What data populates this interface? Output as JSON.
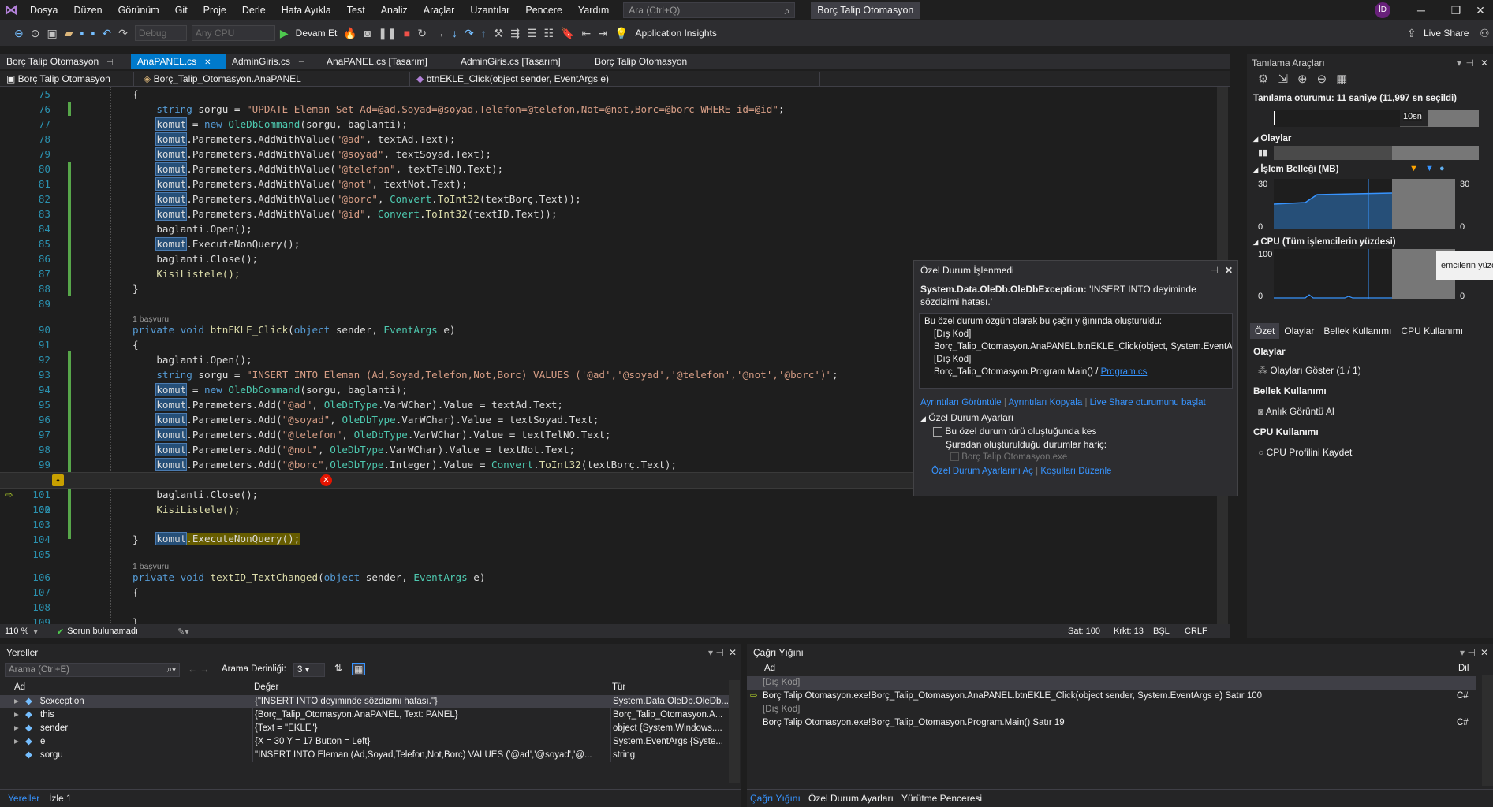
{
  "menu": {
    "items": [
      "Dosya",
      "Düzen",
      "Görünüm",
      "Git",
      "Proje",
      "Derle",
      "Hata Ayıkla",
      "Test",
      "Analiz",
      "Araçlar",
      "Uzantılar",
      "Pencere",
      "Yardım"
    ],
    "search_placeholder": "Ara (Ctrl+Q)",
    "solution": "Borç Talip Otomasyon",
    "avatar": "İD"
  },
  "toolbar": {
    "config": "Debug",
    "platform": "Any CPU",
    "continue": "Devam Et",
    "insights": "Application Insights",
    "live_share": "Live Share"
  },
  "tabs": [
    "Borç Talip Otomasyon",
    "AnaPANEL.cs",
    "AdminGiris.cs",
    "AnaPANEL.cs [Tasarım]",
    "AdminGiris.cs [Tasarım]",
    "Borç Talip Otomasyon"
  ],
  "navbar": {
    "project": "Borç Talip Otomasyon",
    "class": "Borç_Talip_Otomasyon.AnaPANEL",
    "member": "btnEKLE_Click(object sender, EventArgs e)"
  },
  "code": {
    "refs1": "1 başvuru",
    "refs2": "1 başvuru",
    "l75": "{",
    "l76a": "string",
    "l76b": " sorgu = ",
    "l76c": "\"UPDATE Eleman Set Ad=@ad,Soyad=@soyad,Telefon=@telefon,Not=@not,Borc=@borc WHERE id=@id\"",
    "l76d": ";",
    "l77": "komut",
    "l77b": " = ",
    "l77c": "new ",
    "l77d": "OleDbCommand",
    "l77e": "(sorgu, baglanti);",
    "p78": "\"@ad\"",
    "p78b": ", textAd.Text);",
    "p79": "\"@soyad\"",
    "p79b": ", textSoyad.Text);",
    "p80": "\"@telefon\"",
    "p80b": ", textTelNO.Text);",
    "p81": "\"@not\"",
    "p81b": ", textNot.Text);",
    "p82": "\"@borc\"",
    "p82b": "(textBorç.Text));",
    "p83": "\"@id\"",
    "p83b": "(textID.Text));",
    "addwv": ".Parameters.AddWithValue(",
    "conv": "Convert",
    "toint": "ToInt32",
    "l84": "baglanti.Open();",
    "l85": ".ExecuteNonQuery();",
    "l86": "baglanti.Close();",
    "l87": "KisiListele();",
    "l88": "}",
    "l90a": "private ",
    "l90b": "void ",
    "l90c": "btnEKLE_Click",
    "l90d": "(",
    "l90e": "object ",
    "l90f": "sender, ",
    "l90g": "EventArgs ",
    "l90h": "e)",
    "l91": "{",
    "l92": "baglanti.Open();",
    "l93c": "\"INSERT INTO Eleman (Ad,Soyad,Telefon,Not,Borc) VALUES ('@ad','@soyad','@telefon','@not','@borc')\"",
    "padd": ".Parameters.Add(",
    "oledbtype": "OleDbType",
    "q95": "\"@ad\"",
    "q95b": ".VarWChar).Value = textAd.Text;",
    "q96": "\"@soyad\"",
    "q96b": ".VarWChar).Value = textSoyad.Text;",
    "q97": "\"@telefon\"",
    "q97b": ".VarWChar).Value = textTelNO.Text;",
    "q98": "\"@not\"",
    "q98b": ".VarWChar).Value = textNot.Text;",
    "q99": "\"@borc\"",
    "q99b": ".Integer).Value = ",
    "q99c": "(textBorç.Text);",
    "l101": "baglanti.Close();",
    "l102": "KisiListele();",
    "l104": "}",
    "l106c": "textID_TextChanged",
    "l107": "{",
    "l109": "}"
  },
  "exception": {
    "header": "Özel Durum İşlenmedi",
    "type": "System.Data.OleDb.OleDbException:",
    "message": " 'INSERT INTO deyiminde sözdizimi hatası.'",
    "stack_intro": "Bu özel durum özgün olarak bu çağrı yığınında oluşturuldu:",
    "stack": [
      "[Dış Kod]",
      "Borç_Talip_Otomasyon.AnaPANEL.btnEKLE_Click(object, System.EventArgs)",
      "[Dış Kod]",
      "Borç_Talip_Otomasyon.Program.Main() / "
    ],
    "program_link": "Program.cs",
    "links": [
      "Ayrıntıları Görüntüle",
      "Ayrıntıları Kopyala",
      "Live Share oturumunu başlat"
    ],
    "settings_title": "Özel Durum Ayarları",
    "break_label": "Bu özel durum türü oluştuğunda kes",
    "except_label": "Şuradan oluşturulduğu durumlar hariç:",
    "except_item": "Borç Talip Otomasyon.exe",
    "settings_links": [
      "Özel Durum Ayarlarını Aç",
      "Koşulları Düzenle"
    ]
  },
  "diagnostics": {
    "title": "Tanılama Araçları",
    "session": "Tanılama oturumu: 11 saniye (11,997 sn seçildi)",
    "time_label": "10sn",
    "events": "Olaylar",
    "memory": "İşlem Belleği (MB)",
    "mem_max": "30",
    "mem_min": "0",
    "cpu": "CPU (Tüm işlemcilerin yüzdesi)",
    "cpu_max": "100",
    "cpu_min": "0",
    "tooltip": "emcilerin yüzd",
    "subtabs": [
      "Özet",
      "Olaylar",
      "Bellek Kullanımı",
      "CPU Kullanımı"
    ],
    "sec_events": "Olaylar",
    "show_events": "Olayları Göster (1 / 1)",
    "sec_memory": "Bellek Kullanımı",
    "snapshot": "Anlık Görüntü Al",
    "sec_cpu": "CPU Kullanımı",
    "cpu_profile": "CPU Profilini Kaydet"
  },
  "status": {
    "zoom": "110 %",
    "issues": "Sorun bulunamadı",
    "line": "Sat: 100",
    "char": "Krkt: 13",
    "space": "BŞL",
    "eol": "CRLF"
  },
  "locals": {
    "title": "Yereller",
    "search": "Arama (Ctrl+E)",
    "depth_label": "Arama Derinliği:",
    "depth": "3",
    "headers": [
      "Ad",
      "Değer",
      "Tür"
    ],
    "rows": [
      {
        "name": "$exception",
        "value": "{\"INSERT INTO deyiminde sözdizimi hatası.\"}",
        "type": "System.Data.OleDb.OleDb..."
      },
      {
        "name": "this",
        "value": "{Borç_Talip_Otomasyon.AnaPANEL, Text: PANEL}",
        "type": "Borç_Talip_Otomasyon.A..."
      },
      {
        "name": "sender",
        "value": "{Text = \"EKLE\"}",
        "type": "object {System.Windows...."
      },
      {
        "name": "e",
        "value": "{X = 30 Y = 17 Button = Left}",
        "type": "System.EventArgs {Syste..."
      },
      {
        "name": "sorgu",
        "value": "\"INSERT INTO Eleman (Ad,Soyad,Telefon,Not,Borc) VALUES ('@ad','@soyad','@...",
        "type": "string"
      }
    ],
    "bottom_tabs": [
      "Yereller",
      "İzle 1"
    ]
  },
  "callstack": {
    "title": "Çağrı Yığını",
    "headers": [
      "Ad",
      "Dil"
    ],
    "rows": [
      {
        "name": "[Dış Kod]",
        "lang": ""
      },
      {
        "name": "Borç Talip Otomasyon.exe!Borç_Talip_Otomasyon.AnaPANEL.btnEKLE_Click(object sender, System.EventArgs e) Satır 100",
        "lang": "C#"
      },
      {
        "name": "[Dış Kod]",
        "lang": ""
      },
      {
        "name": "Borç Talip Otomasyon.exe!Borç_Talip_Otomasyon.Program.Main() Satır 19",
        "lang": "C#"
      }
    ],
    "bottom_tabs": [
      "Çağrı Yığını",
      "Özel Durum Ayarları",
      "Yürütme Penceresi"
    ]
  },
  "colors": {
    "accent": "#007acc",
    "keyword": "#569cd6",
    "string": "#d69d85",
    "type": "#4ec9b0",
    "method": "#dcdcaa",
    "linenum": "#2b91af"
  }
}
